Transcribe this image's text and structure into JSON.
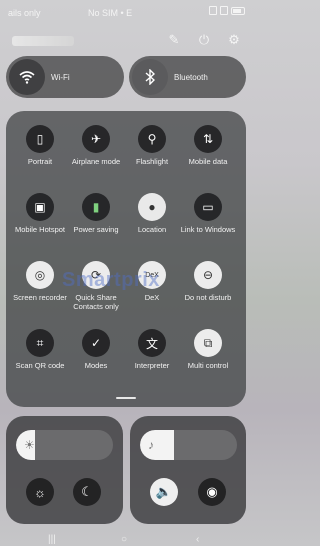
{
  "status": {
    "left": "ails only",
    "mid": "No SIM • E"
  },
  "wifi": {
    "label": "Wi-Fi"
  },
  "bluetooth": {
    "label": "Bluetooth"
  },
  "tiles": [
    {
      "label": "Portrait"
    },
    {
      "label": "Airplane mode"
    },
    {
      "label": "Flashlight"
    },
    {
      "label": "Mobile data"
    },
    {
      "label": "Mobile Hotspot"
    },
    {
      "label": "Power saving"
    },
    {
      "label": "Location"
    },
    {
      "label": "Link to Windows"
    },
    {
      "label": "Screen recorder"
    },
    {
      "label": "Quick Share Contacts only"
    },
    {
      "label": "DeX"
    },
    {
      "label": "Do not disturb"
    },
    {
      "label": "Scan QR code"
    },
    {
      "label": "Modes"
    },
    {
      "label": "Interpreter"
    },
    {
      "label": "Multi control"
    }
  ],
  "watermark": "Smartprix",
  "brightness": {
    "level": 0.2
  },
  "volume": {
    "level": 0.35
  },
  "icons": {
    "edit": "pencil-icon",
    "power": "power-icon",
    "settings": "gear-icon"
  }
}
